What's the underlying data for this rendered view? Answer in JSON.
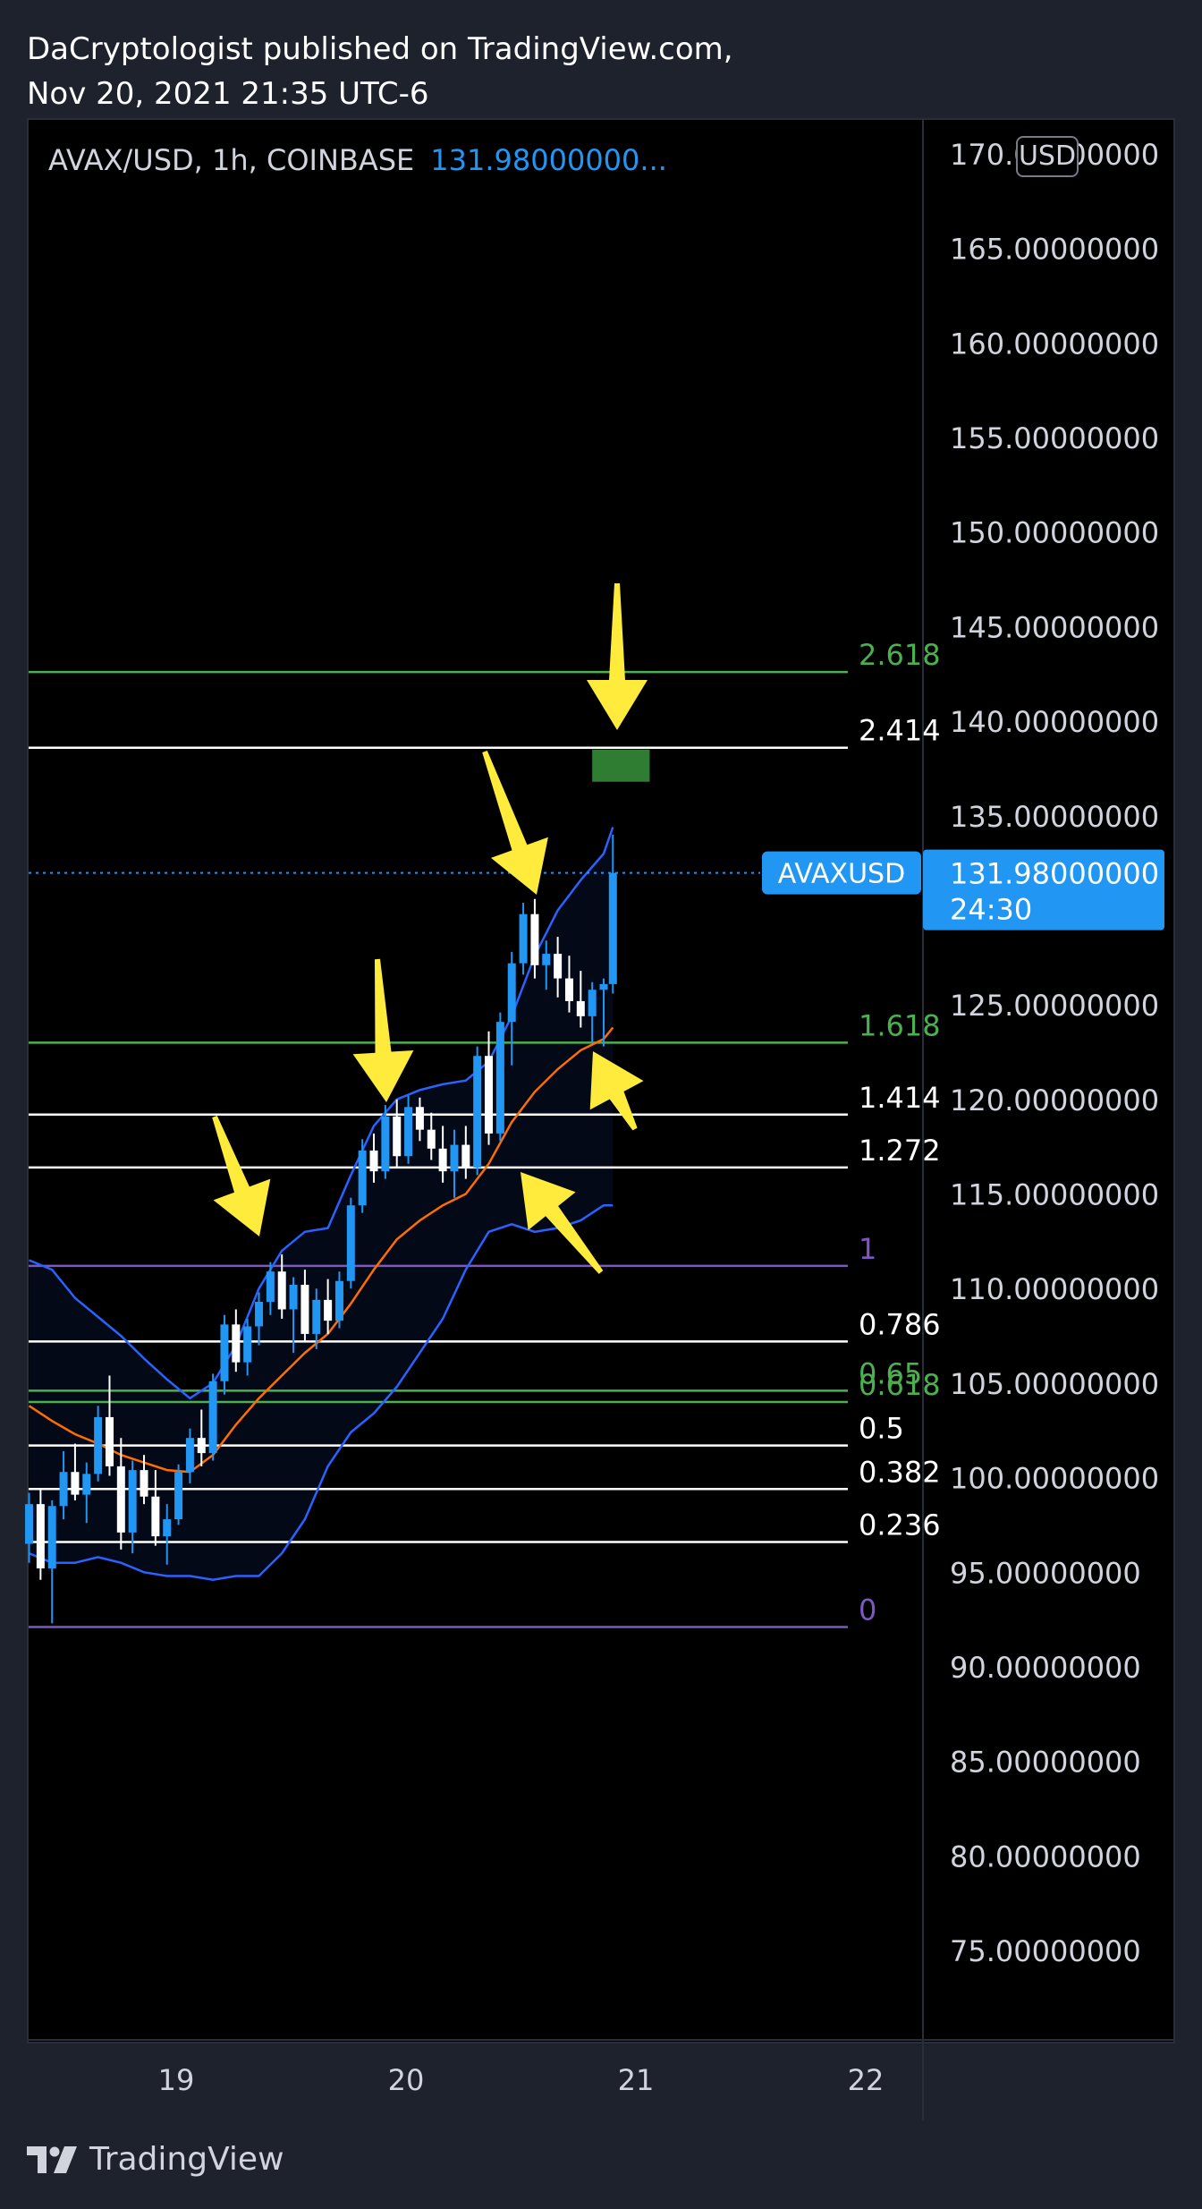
{
  "header": {
    "published_line": "DaCryptologist published on TradingView.com,",
    "date_line": "Nov 20, 2021 21:35 UTC-6"
  },
  "symbol": {
    "text": "AVAX/USD, 1h, COINBASE",
    "last_price": "131.98000000..."
  },
  "currency": "USD",
  "price_tag": {
    "symbol": "AVAXUSD",
    "price": "131.98000000",
    "countdown": "24:30"
  },
  "footer": {
    "brand": "TradingView"
  },
  "colors": {
    "up": "#2196f3",
    "down": "#ffffff",
    "bb_band": "#2962ff",
    "bb_basis": "#ff6d00",
    "fib_white": "#ffffff",
    "fib_green": "#4caf50",
    "fib_purple": "#7e57c2",
    "arrow": "#ffeb3b",
    "target_box": "#2e7d32"
  },
  "chart_data": {
    "type": "candlestick",
    "y_ticks": [
      "170.00000000",
      "165.00000000",
      "160.00000000",
      "155.00000000",
      "150.00000000",
      "145.00000000",
      "140.00000000",
      "135.00000000",
      "125.00000000",
      "120.00000000",
      "115.00000000",
      "110.00000000",
      "105.00000000",
      "100.00000000",
      "95.00000000",
      "90.00000000",
      "85.00000000",
      "80.00000000",
      "75.00000000"
    ],
    "y_tick_values": [
      170,
      165,
      160,
      155,
      150,
      145,
      140,
      135,
      125,
      120,
      115,
      110,
      105,
      100,
      95,
      90,
      85,
      80,
      75
    ],
    "ylim": [
      70,
      172
    ],
    "x_ticks": [
      {
        "label": "19",
        "value": 19
      },
      {
        "label": "20",
        "value": 20
      },
      {
        "label": "21",
        "value": 21
      },
      {
        "label": "22",
        "value": 22
      }
    ],
    "xlim": [
      18.35,
      22.1
    ],
    "fib_levels": [
      {
        "label": "2.618",
        "value": 142.6,
        "color": "green"
      },
      {
        "label": "2.414",
        "value": 138.6,
        "color": "white"
      },
      {
        "label": "1.618",
        "value": 123.0,
        "color": "green"
      },
      {
        "label": "1.414",
        "value": 119.2,
        "color": "white"
      },
      {
        "label": "1.272",
        "value": 116.4,
        "color": "white"
      },
      {
        "label": "1",
        "value": 111.2,
        "color": "purple"
      },
      {
        "label": "0.786",
        "value": 107.2,
        "color": "white"
      },
      {
        "label": "0.65",
        "value": 104.6,
        "color": "green"
      },
      {
        "label": "0.618",
        "value": 104.0,
        "color": "green"
      },
      {
        "label": "0.5",
        "value": 101.7,
        "color": "white"
      },
      {
        "label": "0.382",
        "value": 99.4,
        "color": "white"
      },
      {
        "label": "0.236",
        "value": 96.6,
        "color": "white"
      },
      {
        "label": "0",
        "value": 92.1,
        "color": "purple"
      }
    ],
    "last_price": 131.98,
    "target_zone": {
      "x0": 20.81,
      "x1": 21.06,
      "y0": 136.8,
      "y1": 138.5
    },
    "candles": [
      [
        18.36,
        96.5,
        99.2,
        95.5,
        98.6
      ],
      [
        18.41,
        98.6,
        99.4,
        94.6,
        95.2
      ],
      [
        18.46,
        95.2,
        98.8,
        92.3,
        98.5
      ],
      [
        18.51,
        98.5,
        101.4,
        97.8,
        100.3
      ],
      [
        18.56,
        100.3,
        101.8,
        98.8,
        99.1
      ],
      [
        18.61,
        99.1,
        100.8,
        97.6,
        100.2
      ],
      [
        18.66,
        100.2,
        103.8,
        99.8,
        103.2
      ],
      [
        18.71,
        103.2,
        105.4,
        100.1,
        100.6
      ],
      [
        18.76,
        100.6,
        102.1,
        96.2,
        97.1
      ],
      [
        18.81,
        97.1,
        100.9,
        96.0,
        100.4
      ],
      [
        18.86,
        100.4,
        101.2,
        98.6,
        99.0
      ],
      [
        18.91,
        99.0,
        100.4,
        96.4,
        96.9
      ],
      [
        18.96,
        96.9,
        98.6,
        95.4,
        97.8
      ],
      [
        19.01,
        97.8,
        100.7,
        97.5,
        100.3
      ],
      [
        19.06,
        100.3,
        102.6,
        99.7,
        102.1
      ],
      [
        19.11,
        102.1,
        103.6,
        100.6,
        101.3
      ],
      [
        19.16,
        101.3,
        105.5,
        100.9,
        105.1
      ],
      [
        19.21,
        105.1,
        108.6,
        104.4,
        108.1
      ],
      [
        19.26,
        108.1,
        108.9,
        105.6,
        106.1
      ],
      [
        19.31,
        106.1,
        108.4,
        105.4,
        108.0
      ],
      [
        19.36,
        108.0,
        109.8,
        107.0,
        109.3
      ],
      [
        19.41,
        109.3,
        111.4,
        108.6,
        110.9
      ],
      [
        19.46,
        110.9,
        111.8,
        108.4,
        108.9
      ],
      [
        19.51,
        108.9,
        110.6,
        106.6,
        110.2
      ],
      [
        19.56,
        110.2,
        111.0,
        107.2,
        107.6
      ],
      [
        19.61,
        107.6,
        110.0,
        106.8,
        109.4
      ],
      [
        19.66,
        109.4,
        110.5,
        107.6,
        108.3
      ],
      [
        19.71,
        108.3,
        110.9,
        107.9,
        110.4
      ],
      [
        19.76,
        110.4,
        114.8,
        110.0,
        114.4
      ],
      [
        19.81,
        114.4,
        117.9,
        114.0,
        117.3
      ],
      [
        19.86,
        117.3,
        118.2,
        115.6,
        116.2
      ],
      [
        19.91,
        116.2,
        119.7,
        115.8,
        119.1
      ],
      [
        19.96,
        119.1,
        120.0,
        116.4,
        117.0
      ],
      [
        20.01,
        117.0,
        120.2,
        116.6,
        119.6
      ],
      [
        20.06,
        119.6,
        120.1,
        117.8,
        118.4
      ],
      [
        20.11,
        118.4,
        119.3,
        116.8,
        117.4
      ],
      [
        20.16,
        117.4,
        118.6,
        115.6,
        116.2
      ],
      [
        20.21,
        116.2,
        118.4,
        114.8,
        117.6
      ],
      [
        20.26,
        117.6,
        118.6,
        115.8,
        116.4
      ],
      [
        20.31,
        116.4,
        122.8,
        116.0,
        122.3
      ],
      [
        20.36,
        122.3,
        123.6,
        117.6,
        118.2
      ],
      [
        20.41,
        118.2,
        124.6,
        117.8,
        124.1
      ],
      [
        20.46,
        124.1,
        127.8,
        121.8,
        127.2
      ],
      [
        20.51,
        127.2,
        130.4,
        126.6,
        129.8
      ],
      [
        20.56,
        129.8,
        130.6,
        126.4,
        127.1
      ],
      [
        20.61,
        127.1,
        128.4,
        125.8,
        127.7
      ],
      [
        20.66,
        127.7,
        128.6,
        125.4,
        126.4
      ],
      [
        20.71,
        126.4,
        127.6,
        124.6,
        125.2
      ],
      [
        20.76,
        125.2,
        126.8,
        123.8,
        124.4
      ],
      [
        20.81,
        124.4,
        126.2,
        123.0,
        125.8
      ],
      [
        20.86,
        125.8,
        126.4,
        122.8,
        126.1
      ],
      [
        20.9,
        126.1,
        134.0,
        125.6,
        131.98
      ]
    ],
    "bb_upper": [
      [
        18.36,
        111.5
      ],
      [
        18.46,
        111.0
      ],
      [
        18.56,
        109.5
      ],
      [
        18.66,
        108.5
      ],
      [
        18.76,
        107.5
      ],
      [
        18.86,
        106.3
      ],
      [
        18.96,
        105.2
      ],
      [
        19.06,
        104.2
      ],
      [
        19.16,
        105.0
      ],
      [
        19.26,
        107.0
      ],
      [
        19.36,
        110.0
      ],
      [
        19.46,
        112.0
      ],
      [
        19.56,
        113.0
      ],
      [
        19.66,
        113.2
      ],
      [
        19.76,
        116.0
      ],
      [
        19.86,
        118.6
      ],
      [
        19.96,
        120.0
      ],
      [
        20.06,
        120.5
      ],
      [
        20.16,
        120.8
      ],
      [
        20.26,
        121.0
      ],
      [
        20.36,
        122.0
      ],
      [
        20.46,
        124.4
      ],
      [
        20.56,
        127.6
      ],
      [
        20.66,
        130.0
      ],
      [
        20.76,
        131.6
      ],
      [
        20.86,
        133.0
      ],
      [
        20.9,
        134.4
      ]
    ],
    "bb_basis": [
      [
        18.36,
        103.8
      ],
      [
        18.46,
        103.0
      ],
      [
        18.56,
        102.3
      ],
      [
        18.66,
        101.8
      ],
      [
        18.76,
        101.2
      ],
      [
        18.86,
        100.8
      ],
      [
        18.96,
        100.4
      ],
      [
        19.06,
        100.3
      ],
      [
        19.16,
        101.2
      ],
      [
        19.26,
        102.8
      ],
      [
        19.36,
        104.2
      ],
      [
        19.46,
        105.4
      ],
      [
        19.56,
        106.6
      ],
      [
        19.66,
        107.6
      ],
      [
        19.76,
        109.2
      ],
      [
        19.86,
        111.0
      ],
      [
        19.96,
        112.6
      ],
      [
        20.06,
        113.6
      ],
      [
        20.16,
        114.4
      ],
      [
        20.26,
        115.0
      ],
      [
        20.36,
        116.6
      ],
      [
        20.46,
        118.8
      ],
      [
        20.56,
        120.4
      ],
      [
        20.66,
        121.6
      ],
      [
        20.76,
        122.6
      ],
      [
        20.86,
        123.2
      ],
      [
        20.9,
        123.8
      ]
    ],
    "bb_lower": [
      [
        18.36,
        96.0
      ],
      [
        18.46,
        95.5
      ],
      [
        18.56,
        95.5
      ],
      [
        18.66,
        95.8
      ],
      [
        18.76,
        95.5
      ],
      [
        18.86,
        95.0
      ],
      [
        18.96,
        94.8
      ],
      [
        19.06,
        94.8
      ],
      [
        19.16,
        94.6
      ],
      [
        19.26,
        94.8
      ],
      [
        19.36,
        94.8
      ],
      [
        19.46,
        96.0
      ],
      [
        19.56,
        97.8
      ],
      [
        19.66,
        100.6
      ],
      [
        19.76,
        102.4
      ],
      [
        19.86,
        103.4
      ],
      [
        19.96,
        104.8
      ],
      [
        20.06,
        106.6
      ],
      [
        20.16,
        108.4
      ],
      [
        20.26,
        111.0
      ],
      [
        20.36,
        113.0
      ],
      [
        20.46,
        113.4
      ],
      [
        20.56,
        113.0
      ],
      [
        20.66,
        113.2
      ],
      [
        20.76,
        113.6
      ],
      [
        20.86,
        114.4
      ],
      [
        20.9,
        114.4
      ]
    ]
  }
}
